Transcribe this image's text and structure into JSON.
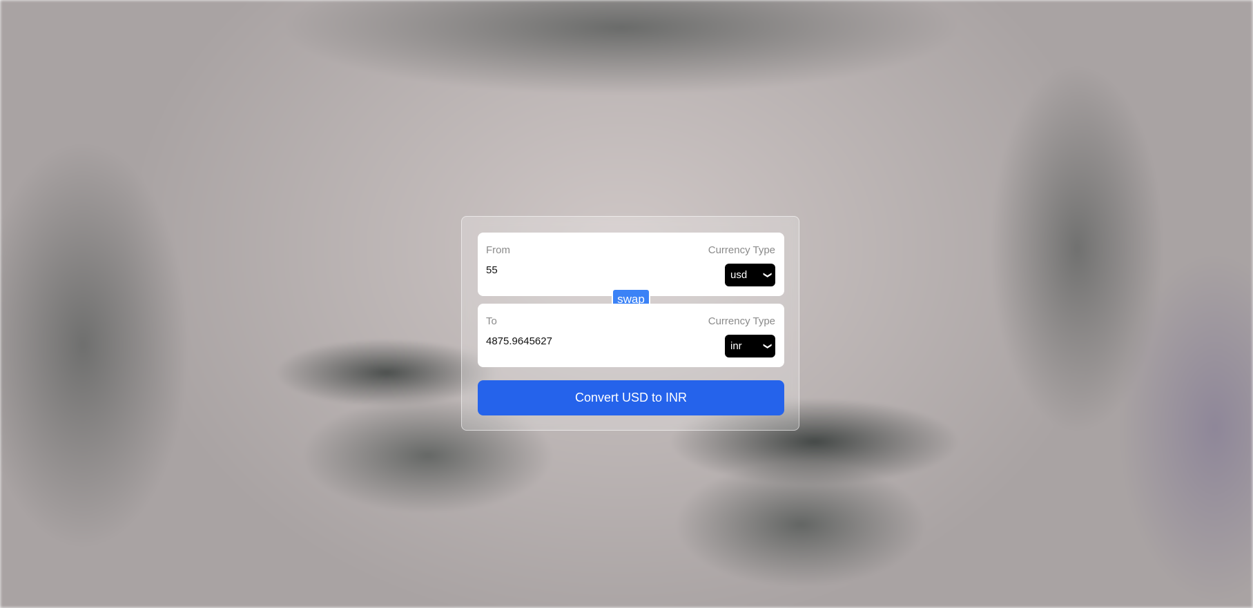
{
  "from": {
    "label": "From",
    "currency_label": "Currency Type",
    "amount": "55",
    "currency": "usd"
  },
  "to": {
    "label": "To",
    "currency_label": "Currency Type",
    "amount": "4875.9645627",
    "currency": "inr"
  },
  "swap_label": "swap",
  "convert_label": "Convert USD to INR",
  "colors": {
    "swap_button": "#3b82f6",
    "convert_button": "#2563eb",
    "select_background": "#000000"
  }
}
